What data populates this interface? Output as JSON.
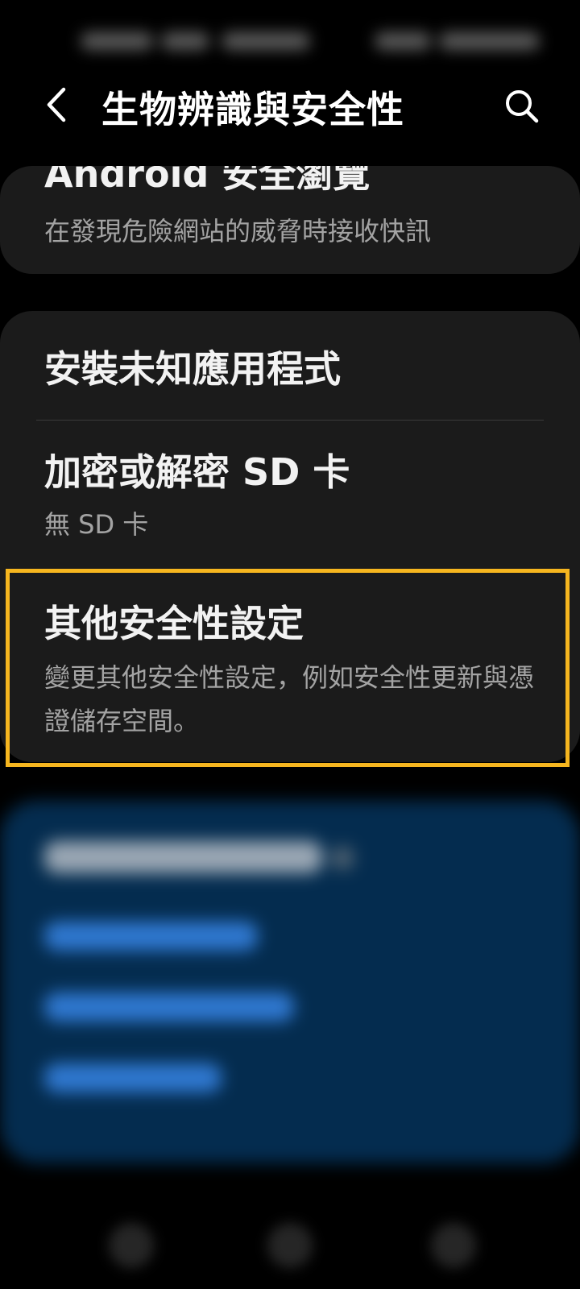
{
  "header": {
    "title": "生物辨識與安全性",
    "back_icon": "chevron-left-icon",
    "search_icon": "search-icon"
  },
  "safe_browsing_card": {
    "title": "Android 安全瀏覽",
    "subtitle": "在發現危險網站的威脅時接收快訊"
  },
  "settings_list": {
    "items": [
      {
        "title": "安裝未知應用程式"
      },
      {
        "title": "加密或解密 SD 卡",
        "subtitle": "無 SD 卡"
      },
      {
        "title": "其他安全性設定",
        "subtitle": "變更其他安全性設定，例如安全性更新與憑證儲存空間。"
      }
    ]
  },
  "colors": {
    "background": "#000000",
    "card": "#1b1b1b",
    "highlight": "#f6b61f",
    "subtitle_text": "#a3a3a3",
    "blue_card": "#042c4f"
  }
}
